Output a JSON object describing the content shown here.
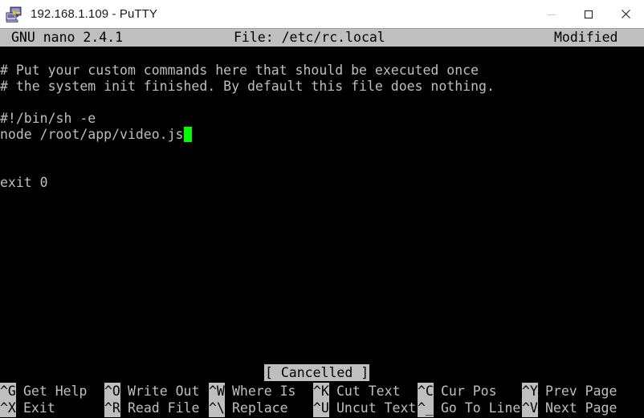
{
  "window": {
    "title": "192.168.1.109 - PuTTY",
    "icon": "putty-computer-icon",
    "controls": {
      "minimize": "minimize-icon",
      "maximize": "maximize-icon",
      "close": "close-icon"
    }
  },
  "nano": {
    "version_label": "GNU nano 2.4.1",
    "file_label": "File: /etc/rc.local",
    "modified_label": "Modified",
    "status_message": "[ Cancelled ]",
    "cursor": {
      "line": 5,
      "column": 24,
      "color": "#00ff00"
    },
    "lines": [
      "# Put your custom commands here that should be executed once",
      "# the system init finished. By default this file does nothing.",
      "",
      "#!/bin/sh -e",
      "node /root/app/video.js",
      "",
      "",
      "exit 0"
    ],
    "shortcuts_row1": [
      {
        "key": "^G",
        "label": "Get Help"
      },
      {
        "key": "^O",
        "label": "Write Out"
      },
      {
        "key": "^W",
        "label": "Where Is"
      },
      {
        "key": "^K",
        "label": "Cut Text"
      },
      {
        "key": "^C",
        "label": "Cur Pos"
      },
      {
        "key": "^Y",
        "label": "Prev Page"
      }
    ],
    "shortcuts_row2": [
      {
        "key": "^X",
        "label": "Exit"
      },
      {
        "key": "^R",
        "label": "Read File"
      },
      {
        "key": "^\\",
        "label": "Replace"
      },
      {
        "key": "^U",
        "label": "Uncut Text"
      },
      {
        "key": "^_",
        "label": "Go To Line"
      },
      {
        "key": "^V",
        "label": "Next Page"
      }
    ]
  },
  "colors": {
    "terminal_bg": "#000000",
    "terminal_fg": "#bfbfbf",
    "inverse_bg": "#bfbfbf",
    "inverse_fg": "#000000",
    "cursor": "#00ff00",
    "titlebar_bg": "#ffffff"
  }
}
